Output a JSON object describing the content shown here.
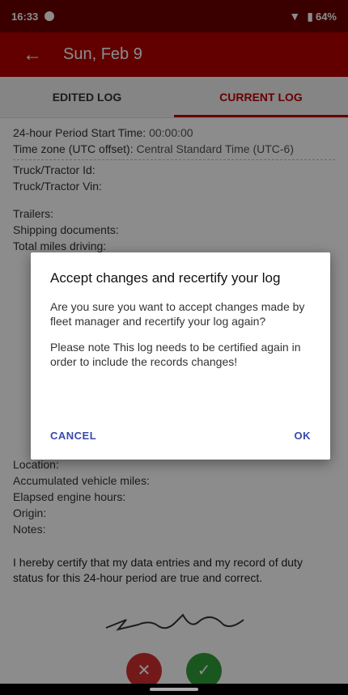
{
  "status_bar": {
    "time": "16:33",
    "battery": "64%"
  },
  "app_bar": {
    "title": "Sun, Feb 9"
  },
  "tabs": [
    {
      "label": "EDITED LOG",
      "active": false
    },
    {
      "label": "CURRENT LOG",
      "active": true
    }
  ],
  "log": {
    "period_start_label": "24-hour Period Start Time:",
    "period_start_value": "00:00:00",
    "time_zone_label": "Time zone (UTC offset):",
    "time_zone_value": "Central Standard Time (UTC-6)",
    "truck_id_label": "Truck/Tractor Id:",
    "truck_id_value": "",
    "truck_vin_label": "Truck/Tractor Vin:",
    "truck_vin_value": "",
    "trailers_label": "Trailers:",
    "trailers_value": "",
    "shipping_docs_label": "Shipping documents:",
    "shipping_docs_value": "",
    "total_miles_label": "Total miles driving:",
    "total_miles_value": "",
    "location_label": "Location:",
    "location_value": "",
    "vehicle_miles_label": "Accumulated vehicle miles:",
    "vehicle_miles_value": "",
    "engine_hours_label": "Elapsed engine hours:",
    "engine_hours_value": "",
    "origin_label": "Origin:",
    "origin_value": "",
    "notes_label": "Notes:",
    "notes_value": ""
  },
  "certification": {
    "text": "I hereby certify that my data entries and my record of duty status for this 24-hour period are true and correct."
  },
  "dialog": {
    "title": "Accept changes and recertify your log",
    "message1": "Are you sure you want to accept changes made by fleet manager and recertify your log again?",
    "message2": "Please note This log needs to be certified again in order to include the records changes!",
    "cancel_label": "CANCEL",
    "ok_label": "OK"
  },
  "colors": {
    "app_bar": "#b30000",
    "status_bar": "#6b0000",
    "accent": "#c00000",
    "dialog_button": "#3949ab",
    "reject": "#d32f2f",
    "accept": "#2e9e3a"
  },
  "icons": {
    "back": "arrow-back-icon",
    "reject": "close-icon",
    "accept": "check-icon"
  }
}
